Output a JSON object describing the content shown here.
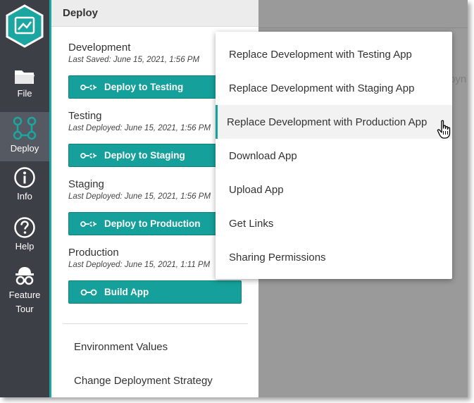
{
  "rail": {
    "items": [
      {
        "label": "File",
        "icon": "folder-icon"
      },
      {
        "label": "Deploy",
        "icon": "deploy-icon"
      },
      {
        "label": "Info",
        "icon": "info-icon"
      },
      {
        "label": "Help",
        "icon": "help-icon"
      },
      {
        "label": "Feature",
        "label2": "Tour",
        "icon": "feature-tour-icon"
      }
    ]
  },
  "panel": {
    "title": "Deploy",
    "environments": [
      {
        "name": "Development",
        "date": "Last Saved: June 15, 2021, 1:56 PM",
        "button": "Deploy to Testing"
      },
      {
        "name": "Testing",
        "date": "Last Deployed: June 15, 2021, 1:56 PM",
        "button": "Deploy to Staging"
      },
      {
        "name": "Staging",
        "date": "Last Deployed: June 15, 2021, 1:56 PM",
        "button": "Deploy to Production"
      },
      {
        "name": "Production",
        "date": "Last Deployed: June 15, 2021, 1:11 PM",
        "button": "Build App"
      }
    ],
    "links": [
      "Environment Values",
      "Change Deployment Strategy"
    ]
  },
  "background_hint": "pyn",
  "menu": {
    "items": [
      "Replace Development with Testing App",
      "Replace Development with Staging App",
      "Replace Development with Production App",
      "Download App",
      "Upload App",
      "Get Links",
      "Sharing Permissions"
    ],
    "active_index": 2
  },
  "colors": {
    "accent": "#16a09b",
    "rail": "#3c3f45",
    "rail_active": "#555a62"
  }
}
